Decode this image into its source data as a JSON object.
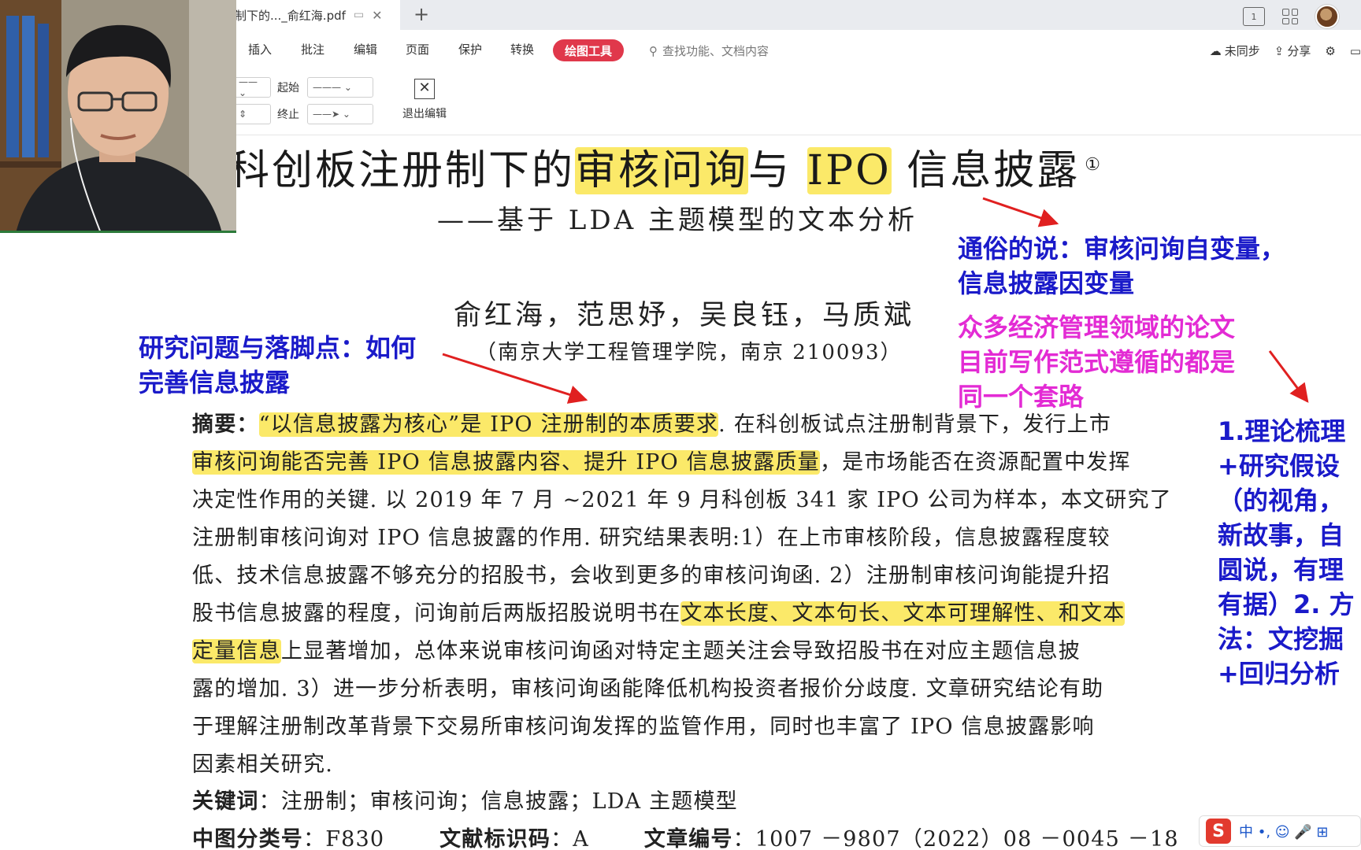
{
  "tab": {
    "title": "制下的..._俞红海.pdf",
    "new_tab": "+",
    "close": "✕"
  },
  "menu": {
    "items": [
      "插入",
      "批注",
      "编辑",
      "页面",
      "保护",
      "转换"
    ],
    "active": "绘图工具",
    "search_placeholder": "查找功能、文档内容",
    "sync": "未同步",
    "share": "分享"
  },
  "drawing_toolbar": {
    "start_label": "起始",
    "end_label": "终止",
    "exit_label": "退出编辑"
  },
  "paper": {
    "title_parts": [
      "科创板注册制下的",
      "审核问询",
      "与",
      "IPO",
      "信息披露"
    ],
    "title_note": "①",
    "subtitle": "——基于 LDA 主题模型的文本分析",
    "authors": "俞红海，范思妤，吴良钰，马质斌",
    "affiliation": "（南京大学工程管理学院，南京 210093）",
    "abstract_label": "摘要：",
    "abstract_lines": [
      [
        {
          "t": "“以信息披露为核心”是 IPO 注册制的本质要求",
          "h": true
        },
        {
          "t": ". 在科创板试点注册制背景下，发行上市",
          "h": false
        }
      ],
      [
        {
          "t": "审核问询能否完善 IPO 信息披露内容、提升 IPO 信息披露质量",
          "h": true
        },
        {
          "t": "，是市场能否在资源配置中发挥",
          "h": false
        }
      ],
      [
        {
          "t": "决定性作用的关键. 以 2019 年 7 月 ~2021 年 9 月科创板 341 家 IPO 公司为样本，本文研究了",
          "h": false
        }
      ],
      [
        {
          "t": "注册制审核问询对 IPO 信息披露的作用. 研究结果表明:1）在上市审核阶段，信息披露程度较",
          "h": false
        }
      ],
      [
        {
          "t": "低、技术信息披露不够充分的招股书，会收到更多的审核问询函. 2）注册制审核问询能提升招",
          "h": false
        }
      ],
      [
        {
          "t": "股书信息披露的程度，问询前后两版招股说明书在",
          "h": false
        },
        {
          "t": "文本长度、文本句长、文本可理解性、和文本",
          "h": true
        }
      ],
      [
        {
          "t": "定量信息",
          "h": true
        },
        {
          "t": "上显著增加，总体来说审核问询函对特定主题关注会导致招股书在对应主题信息披",
          "h": false
        }
      ],
      [
        {
          "t": "露的增加. 3）进一步分析表明，审核问询函能降低机构投资者报价分歧度. 文章研究结论有助",
          "h": false
        }
      ],
      [
        {
          "t": "于理解注册制改革背景下交易所审核问询发挥的监管作用，同时也丰富了 IPO 信息披露影响",
          "h": false
        }
      ],
      [
        {
          "t": "因素相关研究.",
          "h": false
        }
      ]
    ],
    "keywords_label": "关键词",
    "keywords": "：注册制；审核问询；信息披露；LDA 主题模型",
    "class_label": "中图分类号",
    "class_value": "：F830",
    "doc_code_label": "文献标识码",
    "doc_code_value": "：A",
    "article_label": "文章编号",
    "article_value": "：1007 －9807（2022）08 －0045 －18"
  },
  "annotations": {
    "popular": "通俗的说：审核问询自变量，信息披露因变量",
    "research": "研究问题与落脚点：如何完善信息披露",
    "paradigm": "众多经济管理领域的论文目前写作范式遵循的都是同一个套路",
    "steps": "1.理论梳理+研究假设（的视角，新故事，自圆说，有理有据）2. 方法：文挖掘+回归分析"
  },
  "ime": {
    "logo": "S",
    "text": "中 •, ☺ 🎤 ⊞"
  },
  "colors": {
    "accent": "#e0384b",
    "highlight": "#fbe969",
    "note_blue": "#1a1ac9",
    "note_magenta": "#e32bd4",
    "arrow": "#e02020"
  }
}
